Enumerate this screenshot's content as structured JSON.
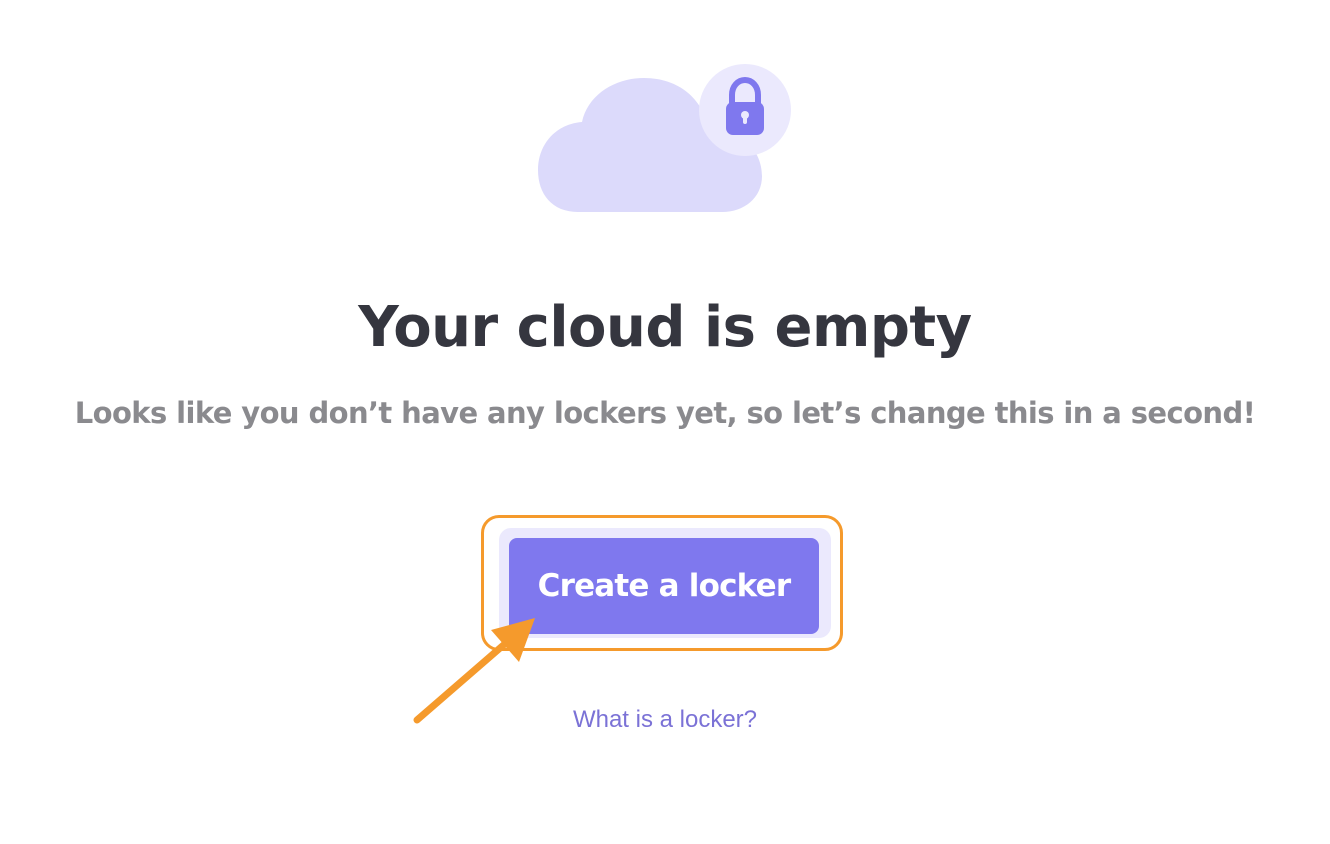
{
  "empty_state": {
    "illustration_icon": "cloud-lock-icon",
    "title": "Your cloud is empty",
    "subtitle": "Looks like you don’t have any lockers yet, so let’s change this in a second!",
    "cta_label": "Create a locker",
    "help_link": "What is a locker?"
  },
  "colors": {
    "title": "#35363f",
    "subtitle": "#8a8a8e",
    "accent": "#7f78ee",
    "accent_light": "#ebe9fd",
    "cloud": "#dcdafb",
    "link": "#7b72d6",
    "annotation": "#f59a2c"
  },
  "annotation": {
    "highlight_target": "cta-button",
    "arrow_icon": "arrow-icon"
  }
}
